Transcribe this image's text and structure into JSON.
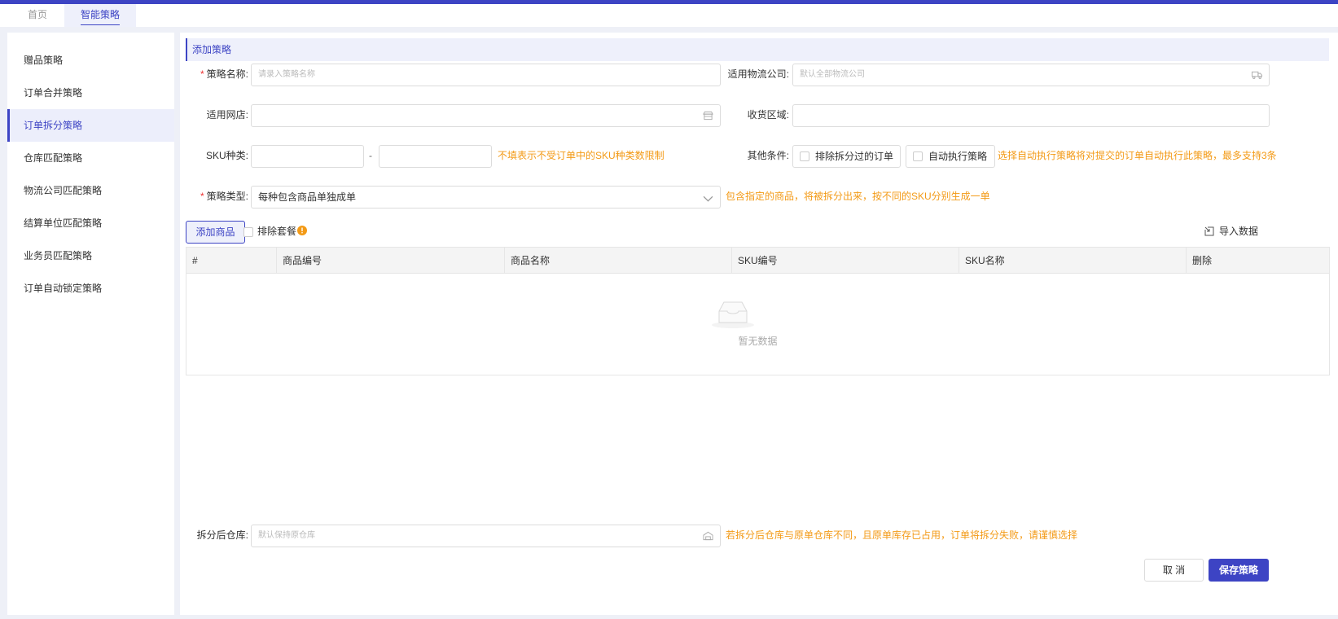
{
  "colors": {
    "accent": "#3d44c4",
    "hint": "#f39a16",
    "required": "#e33333"
  },
  "tabs": [
    {
      "label": "首页"
    },
    {
      "label": "智能策略"
    }
  ],
  "sidebar": {
    "items": [
      {
        "label": "赠品策略"
      },
      {
        "label": "订单合并策略"
      },
      {
        "label": "订单拆分策略"
      },
      {
        "label": "仓库匹配策略"
      },
      {
        "label": "物流公司匹配策略"
      },
      {
        "label": "结算单位匹配策略"
      },
      {
        "label": "业务员匹配策略"
      },
      {
        "label": "订单自动锁定策略"
      }
    ],
    "active": "订单拆分策略"
  },
  "form": {
    "section_title": "添加策略",
    "required_mark": "*",
    "strategy_name": {
      "label": "策略名称:",
      "placeholder": "请录入策略名称"
    },
    "logistics": {
      "label": "适用物流公司:",
      "placeholder": "默认全部物流公司",
      "icon": "truck-icon"
    },
    "store": {
      "label": "适用网店:",
      "value": "",
      "icon": "store-icon"
    },
    "region": {
      "label": "收货区域:",
      "value": ""
    },
    "sku_types": {
      "label": "SKU种类:",
      "min": "",
      "max": "",
      "separator": "-",
      "hint": "不填表示不受订单中的SKU种类数限制"
    },
    "other": {
      "label": "其他条件:",
      "exclude_split": "排除拆分过的订单",
      "auto_execute": "自动执行策略",
      "hint": "选择自动执行策略将对提交的订单自动执行此策略，最多支持3条"
    },
    "strategy_type": {
      "label": "策略类型:",
      "value": "每种包含商品单独成单",
      "hint": "包含指定的商品，将被拆分出来，按不同的SKU分别生成一单"
    }
  },
  "products": {
    "add_button": "添加商品",
    "exclude_combo": "排除套餐",
    "import_button": "导入数据",
    "columns": [
      "#",
      "商品编号",
      "商品名称",
      "SKU编号",
      "SKU名称",
      "删除"
    ],
    "rows": [],
    "empty_text": "暂无数据"
  },
  "warehouse": {
    "label": "拆分后仓库:",
    "placeholder": "默认保持原仓库",
    "hint": "若拆分后仓库与原单仓库不同，且原单库存已占用，订单将拆分失败，请谨慎选择"
  },
  "footer": {
    "cancel": "取 消",
    "save": "保存策略"
  }
}
